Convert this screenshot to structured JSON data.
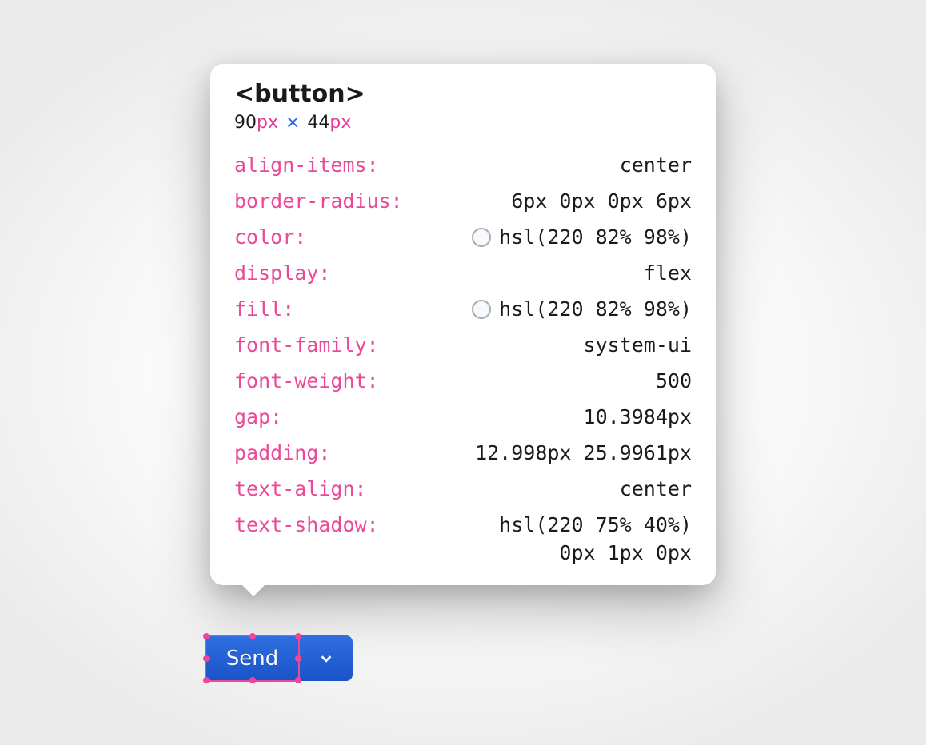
{
  "tooltip": {
    "element_tag": "<button>",
    "dimensions": {
      "width_num": "90",
      "width_unit": "px",
      "separator": "×",
      "height_num": "44",
      "height_unit": "px"
    },
    "properties": [
      {
        "name": "align-items:",
        "value": "center",
        "swatch": false
      },
      {
        "name": "border-radius:",
        "value": "6px 0px 0px 6px",
        "swatch": false
      },
      {
        "name": "color:",
        "value": "hsl(220 82% 98%)",
        "swatch": true
      },
      {
        "name": "display:",
        "value": "flex",
        "swatch": false
      },
      {
        "name": "fill:",
        "value": "hsl(220 82% 98%)",
        "swatch": true
      },
      {
        "name": "font-family:",
        "value": "system-ui",
        "swatch": false
      },
      {
        "name": "font-weight:",
        "value": "500",
        "swatch": false
      },
      {
        "name": "gap:",
        "value": "10.3984px",
        "swatch": false
      },
      {
        "name": "padding:",
        "value": "12.998px 25.9961px",
        "swatch": false
      },
      {
        "name": "text-align:",
        "value": "center",
        "swatch": false
      },
      {
        "name": "text-shadow:",
        "value": "hsl(220 75% 40%)",
        "value2": "0px 1px 0px",
        "swatch": false
      }
    ]
  },
  "button": {
    "label": "Send"
  },
  "colors": {
    "swatch_hsl": "hsl(220, 82%, 98%)",
    "accent_pink": "#ec4899",
    "accent_blue": "#2563eb"
  }
}
